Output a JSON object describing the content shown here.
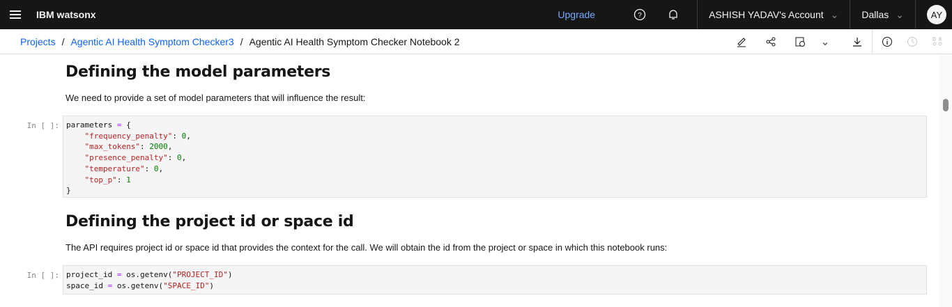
{
  "header": {
    "brand": "IBM watsonx",
    "upgrade": "Upgrade",
    "account": "ASHISH YADAV's Account",
    "region": "Dallas",
    "avatar": "AY"
  },
  "breadcrumb": {
    "items": [
      "Projects",
      "Agentic AI Health Symptom Checker3"
    ],
    "current": "Agentic AI Health Symptom Checker Notebook 2"
  },
  "toolbar": {
    "icons": [
      "edit-icon",
      "share-icon",
      "schedule-icon",
      "chevron-down-icon",
      "download-icon",
      "info-icon",
      "history-icon",
      "apps-icon"
    ]
  },
  "notebook": {
    "section1": {
      "title": "Defining the model parameters",
      "text": "We need to provide a set of model parameters that will influence the result:"
    },
    "cell1": {
      "prompt": "In [ ]:",
      "lines": [
        [
          [
            "parameters ",
            ""
          ],
          [
            "=",
            "o"
          ],
          [
            " {",
            ""
          ]
        ],
        [
          [
            "    ",
            ""
          ],
          [
            "\"frequency_penalty\"",
            "s"
          ],
          [
            ": ",
            ""
          ],
          [
            "0",
            "n"
          ],
          [
            ",",
            ""
          ]
        ],
        [
          [
            "    ",
            ""
          ],
          [
            "\"max_tokens\"",
            "s"
          ],
          [
            ": ",
            ""
          ],
          [
            "2000",
            "n"
          ],
          [
            ",",
            ""
          ]
        ],
        [
          [
            "    ",
            ""
          ],
          [
            "\"presence_penalty\"",
            "s"
          ],
          [
            ": ",
            ""
          ],
          [
            "0",
            "n"
          ],
          [
            ",",
            ""
          ]
        ],
        [
          [
            "    ",
            ""
          ],
          [
            "\"temperature\"",
            "s"
          ],
          [
            ": ",
            ""
          ],
          [
            "0",
            "n"
          ],
          [
            ",",
            ""
          ]
        ],
        [
          [
            "    ",
            ""
          ],
          [
            "\"top_p\"",
            "s"
          ],
          [
            ": ",
            ""
          ],
          [
            "1",
            "n"
          ]
        ],
        [
          [
            "}",
            ""
          ]
        ]
      ]
    },
    "section2": {
      "title": "Defining the project id or space id",
      "text": "The API requires project id or space id that provides the context for the call. We will obtain the id from the project or space in which this notebook runs:"
    },
    "cell2": {
      "prompt": "In [ ]:",
      "lines": [
        [
          [
            "project_id ",
            ""
          ],
          [
            "=",
            "o"
          ],
          [
            " os.getenv(",
            ""
          ],
          [
            "\"PROJECT_ID\"",
            "s"
          ],
          [
            ")",
            ""
          ]
        ],
        [
          [
            "space_id ",
            ""
          ],
          [
            "=",
            "o"
          ],
          [
            " os.getenv(",
            ""
          ],
          [
            "\"SPACE_ID\"",
            "s"
          ],
          [
            ")",
            ""
          ]
        ]
      ]
    }
  }
}
